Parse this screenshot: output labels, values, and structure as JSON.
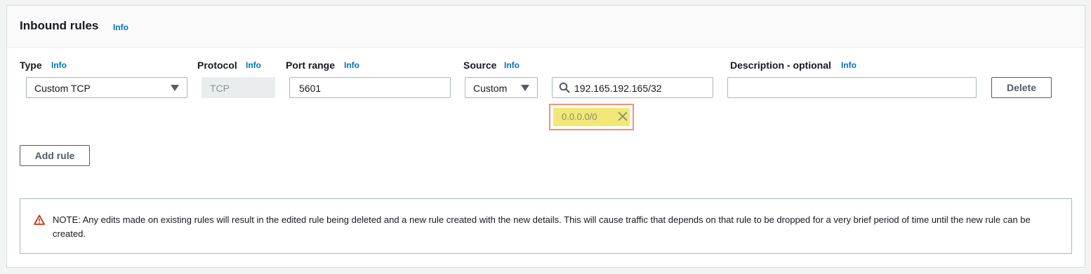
{
  "section": {
    "title": "Inbound rules",
    "info": "Info"
  },
  "columns": {
    "type": {
      "label": "Type",
      "info": "Info"
    },
    "protocol": {
      "label": "Protocol",
      "info": "Info"
    },
    "port_range": {
      "label": "Port range",
      "info": "Info"
    },
    "source": {
      "label": "Source",
      "info": "Info"
    },
    "description": {
      "label": "Description - optional",
      "info": "Info"
    }
  },
  "rule": {
    "type_value": "Custom TCP",
    "protocol_value": "TCP",
    "port_value": "5601",
    "source_value": "Custom",
    "cidr_search_value": "192.165.192.165/32",
    "cidr_token": "0.0.0.0/0",
    "description_value": "",
    "delete_label": "Delete"
  },
  "add_rule_label": "Add rule",
  "note": "NOTE: Any edits made on existing rules will result in the edited rule being deleted and a new rule created with the new details. This will cause traffic that depends on that rule to be dropped for a very brief period of time until the new rule can be created.",
  "icons": {
    "dropdown": "caret-down-icon",
    "search": "search-icon",
    "remove": "close-icon",
    "warning": "warning-icon"
  },
  "colors": {
    "link": "#0073bb",
    "token_highlight": "#f1e877",
    "highlight_border": "#f4907a",
    "warning": "#d13212"
  }
}
